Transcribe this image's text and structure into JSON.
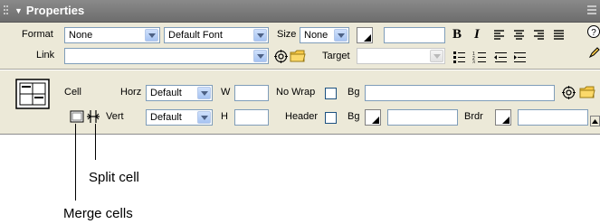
{
  "panel": {
    "title": "Properties"
  },
  "text_props": {
    "format_label": "Format",
    "format_value": "None",
    "font_value": "Default Font",
    "size_label": "Size",
    "size_value": "None",
    "bold_glyph": "B",
    "italic_glyph": "I",
    "link_label": "Link",
    "link_value": "",
    "target_label": "Target",
    "target_value": ""
  },
  "cell_props": {
    "cell_label": "Cell",
    "horz_label": "Horz",
    "horz_value": "Default",
    "w_label": "W",
    "w_value": "",
    "nowrap_label": "No Wrap",
    "bg_label": "Bg",
    "bg_value": "",
    "vert_label": "Vert",
    "vert_value": "Default",
    "h_label": "H",
    "h_value": "",
    "header_label": "Header",
    "bg2_label": "Bg",
    "bg2_value": "",
    "brdr_label": "Brdr",
    "brdr_value": ""
  },
  "annotations": {
    "split_cell": "Split cell",
    "merge_cells": "Merge cells"
  },
  "colors": {
    "panel_bg": "#ece9d8",
    "titlebar": "#7b7b7b",
    "field_border": "#7f9db9",
    "folder": "#f7c948",
    "dropdown_button": "#a6c3f2"
  }
}
